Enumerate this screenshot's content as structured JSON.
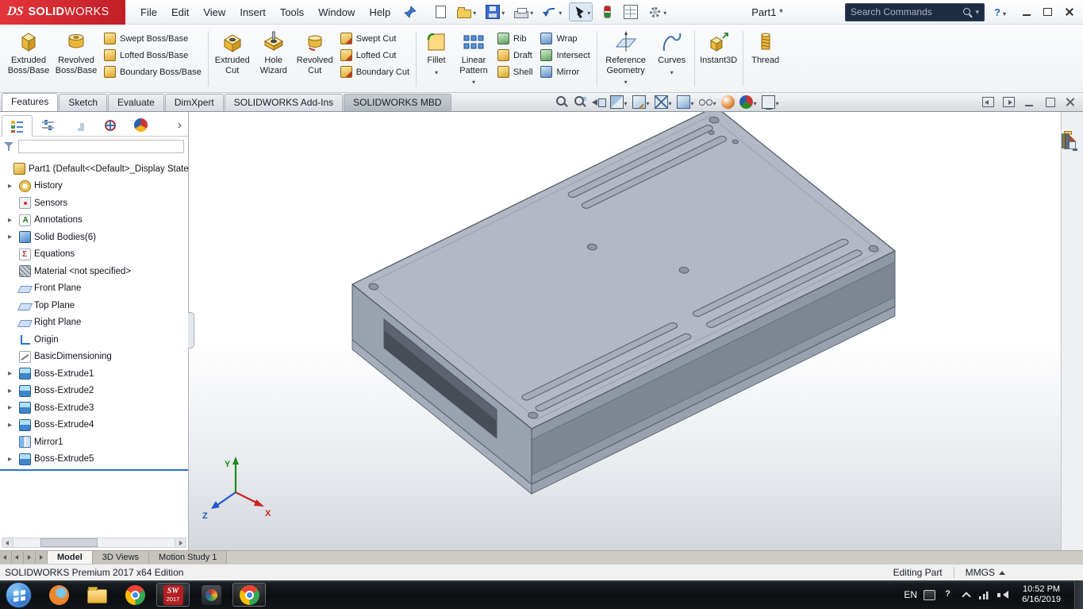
{
  "titlebar": {
    "logo_mark": "DS",
    "logo_solid": "SOLID",
    "logo_works": "WORKS",
    "menus": [
      "File",
      "Edit",
      "View",
      "Insert",
      "Tools",
      "Window",
      "Help"
    ],
    "doc_title": "Part1 *",
    "search_placeholder": "Search Commands",
    "help_glyph": "?"
  },
  "quick_access": [
    {
      "name": "new-document",
      "arrow": "noarr"
    },
    {
      "name": "open",
      "arrow": "arr"
    },
    {
      "name": "save",
      "arrow": "arr"
    },
    {
      "name": "print",
      "arrow": "arr"
    },
    {
      "name": "undo",
      "arrow": "arr"
    },
    {
      "name": "select",
      "arrow": "arr",
      "state": "pressed"
    },
    {
      "name": "rebuild",
      "arrow": "noarr"
    },
    {
      "name": "file-properties",
      "arrow": "noarr"
    },
    {
      "name": "options",
      "arrow": "arr"
    }
  ],
  "ribbon": {
    "extruded_boss": "Extruded Boss/Base",
    "revolved_boss": "Revolved Boss/Base",
    "swept_boss": "Swept Boss/Base",
    "lofted_boss": "Lofted Boss/Base",
    "boundary_boss": "Boundary Boss/Base",
    "extruded_cut": "Extruded Cut",
    "hole_wizard": "Hole Wizard",
    "revolved_cut": "Revolved Cut",
    "swept_cut": "Swept Cut",
    "lofted_cut": "Lofted Cut",
    "boundary_cut": "Boundary Cut",
    "fillet": "Fillet",
    "linear_pattern": "Linear Pattern",
    "rib": "Rib",
    "draft": "Draft",
    "shell": "Shell",
    "wrap": "Wrap",
    "intersect": "Intersect",
    "mirror": "Mirror",
    "reference_geometry": "Reference Geometry",
    "curves": "Curves",
    "instant3d": "Instant3D",
    "thread": "Thread"
  },
  "ribbon_tabs": [
    {
      "label": "Features",
      "state": "active"
    },
    {
      "label": "Sketch",
      "state": "plain"
    },
    {
      "label": "Evaluate",
      "state": "plain"
    },
    {
      "label": "DimXpert",
      "state": "plain"
    },
    {
      "label": "SOLIDWORKS Add-Ins",
      "state": "plain"
    },
    {
      "label": "SOLIDWORKS MBD",
      "state": "dark"
    }
  ],
  "headsup": [
    {
      "name": "zoom-fit",
      "arrow": "noarr"
    },
    {
      "name": "zoom-area",
      "arrow": "noarr"
    },
    {
      "name": "previous-view",
      "arrow": "noarr"
    },
    {
      "name": "section-view",
      "arrow": "arr"
    },
    {
      "name": "drawing-view",
      "arrow": "arr"
    },
    {
      "name": "view-orientation",
      "arrow": "arr"
    },
    {
      "name": "display-style",
      "arrow": "arr"
    },
    {
      "name": "hide-show-items",
      "arrow": "arr"
    },
    {
      "name": "edit-appearance",
      "arrow": "noarr"
    },
    {
      "name": "apply-scene",
      "arrow": "arr"
    },
    {
      "name": "view-settings",
      "arrow": "arr"
    }
  ],
  "pane_controls": [
    "pane-previous",
    "pane-next",
    "minimize-pane",
    "restore-pane",
    "close-pane"
  ],
  "tree": {
    "tabs": [
      "featuremanager",
      "propertymanager",
      "configurationmanager",
      "dimxpertmanager",
      "displaymanager"
    ],
    "items": [
      {
        "label": "Part1 (Default<<Default>_Display State",
        "icon": "part",
        "arrow": "noarr",
        "ind": "d0"
      },
      {
        "label": "History",
        "icon": "history",
        "arrow": "arr",
        "ind": "d1"
      },
      {
        "label": "Sensors",
        "icon": "sensors",
        "arrow": "noarr",
        "ind": "d1"
      },
      {
        "label": "Annotations",
        "icon": "annotations",
        "arrow": "arr",
        "ind": "d1"
      },
      {
        "label": "Solid Bodies(6)",
        "icon": "solidbodies",
        "arrow": "arr",
        "ind": "d1"
      },
      {
        "label": "Equations",
        "icon": "equations",
        "arrow": "noarr",
        "ind": "d1"
      },
      {
        "label": "Material <not specified>",
        "icon": "material",
        "arrow": "noarr",
        "ind": "d1"
      },
      {
        "label": "Front Plane",
        "icon": "plane",
        "arrow": "noarr",
        "ind": "d1"
      },
      {
        "label": "Top Plane",
        "icon": "plane",
        "arrow": "noarr",
        "ind": "d1"
      },
      {
        "label": "Right Plane",
        "icon": "plane",
        "arrow": "noarr",
        "ind": "d1"
      },
      {
        "label": "Origin",
        "icon": "origin",
        "arrow": "noarr",
        "ind": "d1"
      },
      {
        "label": "BasicDimensioning",
        "icon": "sketch",
        "arrow": "noarr",
        "ind": "d1"
      },
      {
        "label": "Boss-Extrude1",
        "icon": "extrude",
        "arrow": "arr",
        "ind": "d1"
      },
      {
        "label": "Boss-Extrude2",
        "icon": "extrude",
        "arrow": "arr",
        "ind": "d1"
      },
      {
        "label": "Boss-Extrude3",
        "icon": "extrude",
        "arrow": "arr",
        "ind": "d1"
      },
      {
        "label": "Boss-Extrude4",
        "icon": "extrude",
        "arrow": "arr",
        "ind": "d1"
      },
      {
        "label": "Mirror1",
        "icon": "mirror",
        "arrow": "noarr",
        "ind": "d1"
      },
      {
        "label": "Boss-Extrude5",
        "icon": "extrude",
        "arrow": "arr",
        "ind": "d1"
      }
    ]
  },
  "viewport": {
    "axis_x": "X",
    "axis_y": "Y",
    "axis_z": "Z"
  },
  "taskpane": [
    "home",
    "design-library",
    "file-explorer",
    "view-palette",
    "appearances",
    "custom-properties",
    "forum"
  ],
  "bottom_tabs": {
    "model": "Model",
    "views_3d": "3D Views",
    "motion": "Motion Study 1"
  },
  "statusbar": {
    "left": "SOLIDWORKS Premium 2017 x64 Edition",
    "editing": "Editing Part",
    "units": "MMGS"
  },
  "taskbar": {
    "apps": [
      "firefox",
      "file-explorer",
      "chrome",
      "solidworks-2017",
      "media-player",
      "chrome-active"
    ],
    "sw_glyph": "SW",
    "sw_year": "2017",
    "tray_lang": "EN",
    "tray_icons": [
      "keyboard",
      "help",
      "chevron-up",
      "network",
      "volume"
    ],
    "time": "10:52 PM",
    "date": "6/16/2019"
  }
}
